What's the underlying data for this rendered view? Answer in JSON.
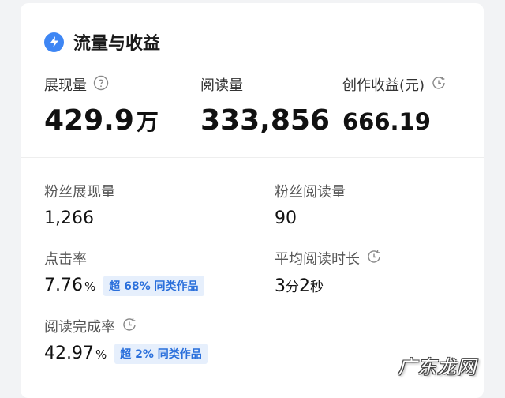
{
  "colors": {
    "accent": "#3e86f4",
    "badge_bg": "#e6effc",
    "badge_text": "#2a6fdb"
  },
  "header": {
    "icon": "lightning-drop-icon",
    "title": "流量与收益"
  },
  "metrics": [
    {
      "label": "展现量",
      "value": "429.9",
      "unit": "万",
      "icon": "help-circle-icon"
    },
    {
      "label": "阅读量",
      "value": "333,856"
    },
    {
      "label": "创作收益(元)",
      "value": "666.19",
      "icon": "clock-icon"
    }
  ],
  "stats": {
    "fan_impressions": {
      "label": "粉丝展现量",
      "value": "1,266"
    },
    "fan_reads": {
      "label": "粉丝阅读量",
      "value": "90"
    },
    "ctr": {
      "label": "点击率",
      "value": "7.76",
      "unit": "%",
      "badge": "超 68% 同类作品"
    },
    "avg_read_time": {
      "label": "平均阅读时长",
      "icon": "clock-icon",
      "min": "3",
      "min_unit": "分",
      "sec": "2",
      "sec_unit": "秒"
    },
    "completion": {
      "label": "阅读完成率",
      "icon": "clock-icon",
      "value": "42.97",
      "unit": "%",
      "badge": "超 2% 同类作品"
    }
  },
  "watermark": "广东龙网"
}
